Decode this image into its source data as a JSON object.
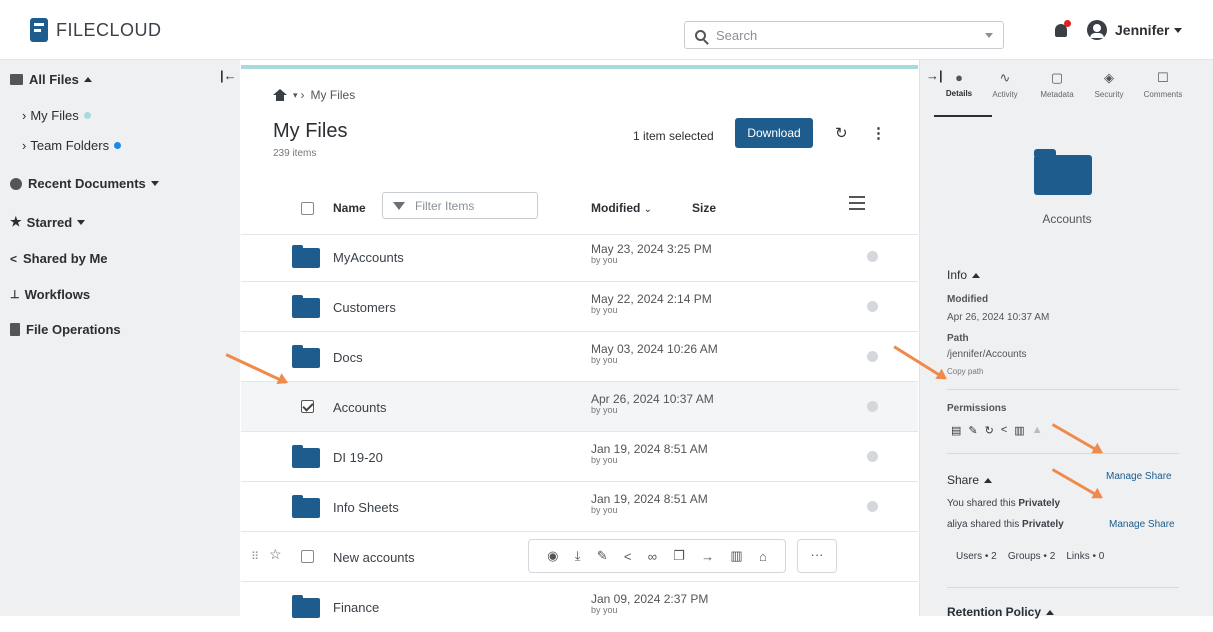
{
  "topbar": {
    "brand": "FILECLOUD",
    "search_placeholder": "Search",
    "user_name": "Jennifer"
  },
  "sidebar": {
    "items": [
      {
        "label": "All Files"
      },
      {
        "label": "My Files"
      },
      {
        "label": "Team Folders"
      },
      {
        "label": "Recent Documents"
      },
      {
        "label": "Starred"
      },
      {
        "label": "Shared by Me"
      },
      {
        "label": "Workflows"
      },
      {
        "label": "File Operations"
      }
    ]
  },
  "main": {
    "breadcrumb": "My Files",
    "title": "My Files",
    "item_count": "239 items",
    "selection_text": "1 item selected",
    "download_label": "Download",
    "columns": {
      "name": "Name",
      "filter_placeholder": "Filter Items",
      "modified": "Modified",
      "size": "Size"
    },
    "rows": [
      {
        "name": "MyAccounts",
        "date": "May 23, 2024 3:25 PM",
        "by": "by you"
      },
      {
        "name": "Customers",
        "date": "May 22, 2024 2:14 PM",
        "by": "by you"
      },
      {
        "name": "Docs",
        "date": "May 03, 2024 10:26 AM",
        "by": "by you"
      },
      {
        "name": "Accounts",
        "date": "Apr 26, 2024 10:37 AM",
        "by": "by you"
      },
      {
        "name": "DI 19-20",
        "date": "Jan 19, 2024 8:51 AM",
        "by": "by you"
      },
      {
        "name": "Info Sheets",
        "date": "Jan 19, 2024 8:51 AM",
        "by": "by you"
      },
      {
        "name": "New accounts",
        "date": "",
        "by": ""
      },
      {
        "name": "Finance",
        "date": "Jan 09, 2024 2:37 PM",
        "by": "by you"
      }
    ],
    "more_label": "···"
  },
  "details": {
    "tabs": [
      "Details",
      "Activity",
      "Metadata",
      "Security",
      "Comments"
    ],
    "name": "Accounts",
    "info_heading": "Info",
    "modified_label": "Modified",
    "modified_value": "Apr 26, 2024 10:37 AM",
    "path_label": "Path",
    "path_value": "/jennifer/Accounts",
    "copy_path": "Copy path",
    "permissions_label": "Permissions",
    "share_heading": "Share",
    "manage_share": "Manage Share",
    "share_line1_prefix": "You shared this ",
    "share_line1_bold": "Privately",
    "share_line2_prefix": "aliya shared this ",
    "share_line2_bold": "Privately",
    "counts": "Users • 2    Groups • 2    Links • 0",
    "retention_heading": "Retention Policy"
  },
  "colors": {
    "accent": "#1d5c8c",
    "annotation_arrow": "#f08a4b",
    "dot_light": "#a8dadc",
    "dot_dark": "#1e88e5"
  }
}
